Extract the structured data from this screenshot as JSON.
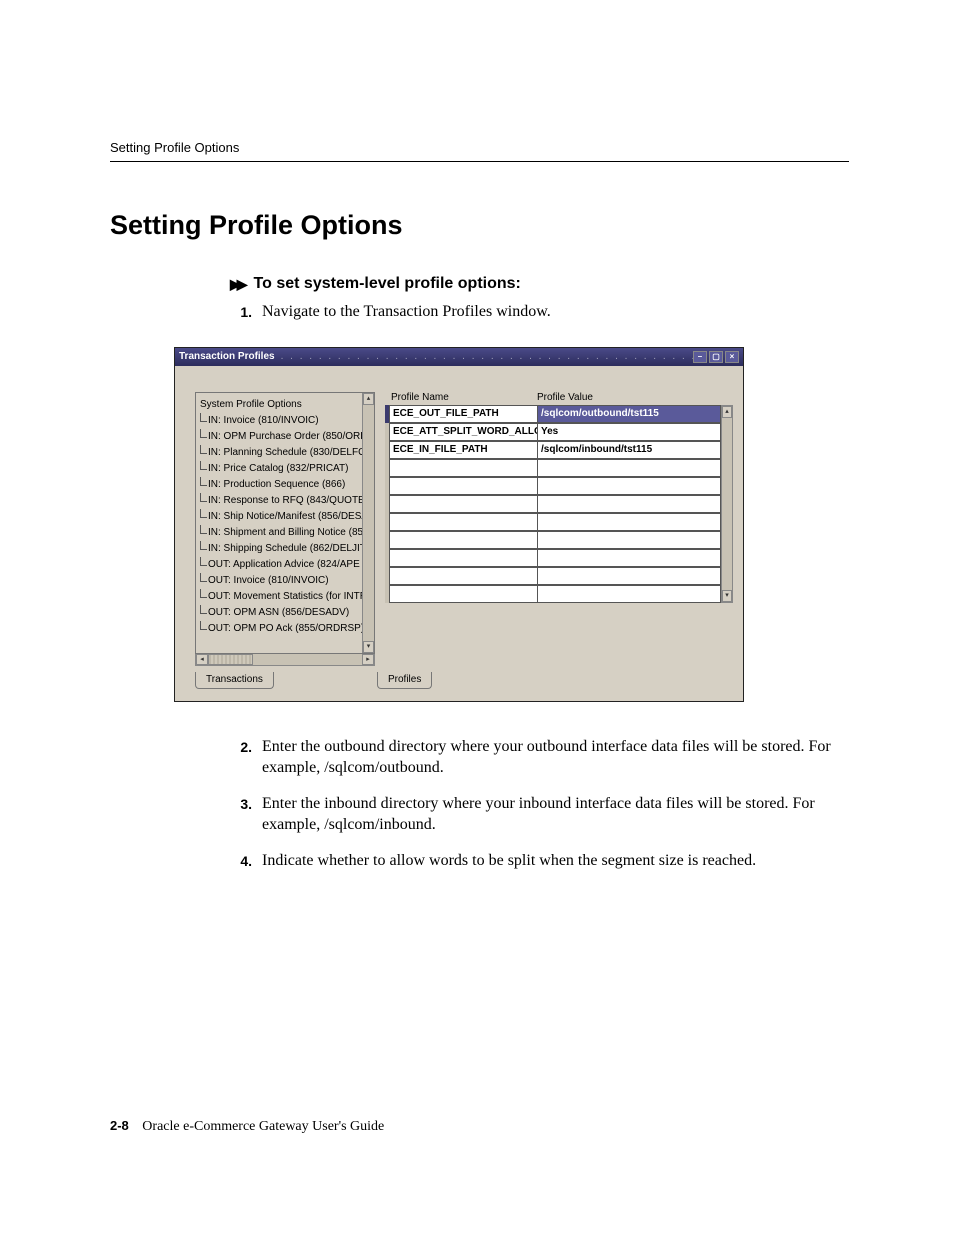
{
  "running_header": "Setting Profile Options",
  "h1": "Setting Profile Options",
  "subhead": "To set system-level profile options:",
  "steps_top": [
    {
      "n": "1.",
      "t": "Navigate to the Transaction Profiles window."
    }
  ],
  "steps_bottom": [
    {
      "n": "2.",
      "t": "Enter the outbound directory where your outbound interface data files will be stored.  For example, /sqlcom/outbound."
    },
    {
      "n": "3.",
      "t": "Enter the inbound directory where your inbound interface data files will be stored.  For example, /sqlcom/inbound."
    },
    {
      "n": "4.",
      "t": "Indicate whether to allow words to be split when the segment size is reached."
    }
  ],
  "footer": {
    "page": "2-8",
    "book": "Oracle e-Commerce Gateway User's Guide"
  },
  "win": {
    "title": "Transaction Profiles",
    "tree_root": "System Profile Options",
    "tree": [
      "IN: Invoice (810/INVOIC)",
      "IN: OPM Purchase Order (850/ORD",
      "IN: Planning Schedule (830/DELFO",
      "IN: Price Catalog (832/PRICAT)",
      "IN: Production Sequence (866)",
      "IN: Response to RFQ (843/QUOTE)",
      "IN: Ship Notice/Manifest (856/DESA",
      "IN: Shipment and Billing Notice (85",
      "IN: Shipping Schedule (862/DELJIT",
      "OUT: Application Advice (824/APE",
      "OUT: Invoice (810/INVOIC)",
      "OUT: Movement Statistics (for INTR",
      "OUT: OPM ASN (856/DESADV)",
      "OUT: OPM PO Ack (855/ORDRSP)"
    ],
    "grid": {
      "h1": "Profile Name",
      "h2": "Profile Value",
      "rows": [
        {
          "name": "ECE_OUT_FILE_PATH",
          "value": "/sqlcom/outbound/tst115",
          "sel": true
        },
        {
          "name": "ECE_ATT_SPLIT_WORD_ALLO",
          "value": "Yes",
          "sel": false
        },
        {
          "name": "ECE_IN_FILE_PATH",
          "value": "/sqlcom/inbound/tst115",
          "sel": false
        },
        {
          "name": "",
          "value": "",
          "sel": false
        },
        {
          "name": "",
          "value": "",
          "sel": false
        },
        {
          "name": "",
          "value": "",
          "sel": false
        },
        {
          "name": "",
          "value": "",
          "sel": false
        },
        {
          "name": "",
          "value": "",
          "sel": false
        },
        {
          "name": "",
          "value": "",
          "sel": false
        },
        {
          "name": "",
          "value": "",
          "sel": false
        },
        {
          "name": "",
          "value": "",
          "sel": false
        }
      ]
    },
    "tab_left": "Transactions",
    "tab_right": "Profiles"
  }
}
